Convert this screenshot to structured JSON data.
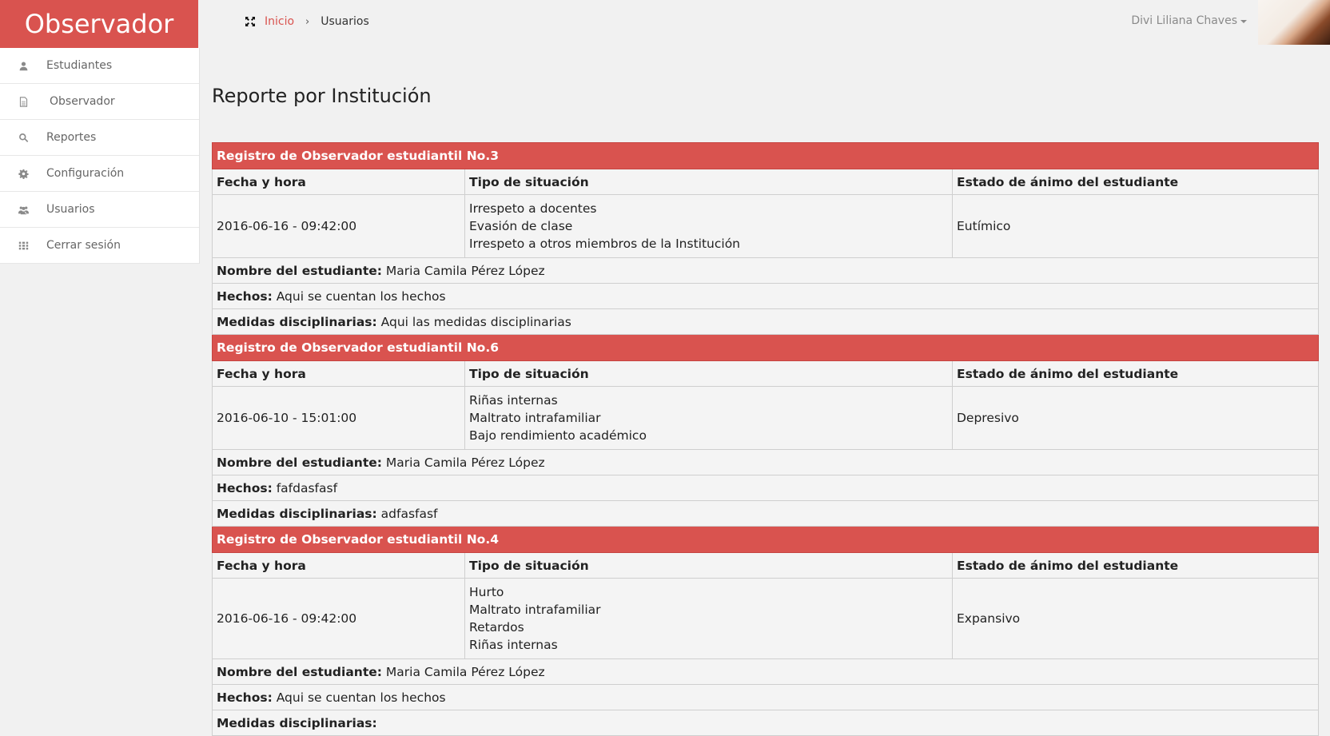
{
  "brand": "Observador",
  "sidebar": {
    "items": [
      {
        "label": "Estudiantes",
        "icon": "user-icon"
      },
      {
        "label": "Observador",
        "icon": "document-icon"
      },
      {
        "label": "Reportes",
        "icon": "search-icon"
      },
      {
        "label": "Configuración",
        "icon": "gear-icon"
      },
      {
        "label": "Usuarios",
        "icon": "users-icon"
      },
      {
        "label": "Cerrar sesión",
        "icon": "grid-icon"
      }
    ]
  },
  "topbar": {
    "breadcrumb": {
      "home": "Inicio",
      "current": "Usuarios"
    },
    "user_name": "Divi Liliana Chaves"
  },
  "page_title": "Reporte por Institución",
  "columns": {
    "date": "Fecha y hora",
    "situation": "Tipo de situación",
    "mood": "Estado de ánimo del estudiante"
  },
  "labels": {
    "student": "Nombre del estudiante:",
    "facts": "Hechos:",
    "measures": "Medidas disciplinarias:"
  },
  "records": [
    {
      "title": "Registro de Observador estudiantil No.3",
      "datetime": "2016-06-16 - 09:42:00",
      "situations": [
        "Irrespeto a docentes",
        "Evasión de clase",
        "Irrespeto a otros miembros de la Institución"
      ],
      "mood": "Eutímico",
      "student": "Maria Camila Pérez López",
      "facts": "Aqui se cuentan los hechos",
      "measures": "Aqui las medidas disciplinarias"
    },
    {
      "title": "Registro de Observador estudiantil No.6",
      "datetime": "2016-06-10 - 15:01:00",
      "situations": [
        "Riñas internas",
        "Maltrato intrafamiliar",
        "Bajo rendimiento académico"
      ],
      "mood": "Depresivo",
      "student": "Maria Camila Pérez López",
      "facts": "fafdasfasf",
      "measures": "adfasfasf"
    },
    {
      "title": "Registro de Observador estudiantil No.4",
      "datetime": "2016-06-16 - 09:42:00",
      "situations": [
        "Hurto",
        "Maltrato intrafamiliar",
        "Retardos",
        "Riñas internas"
      ],
      "mood": "Expansivo",
      "student": "Maria Camila Pérez López",
      "facts": "Aqui se cuentan los hechos",
      "measures": ""
    }
  ]
}
